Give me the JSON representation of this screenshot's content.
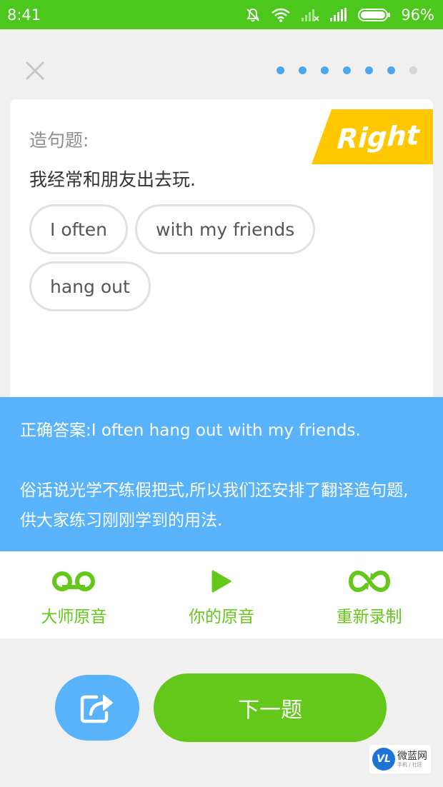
{
  "status_bar": {
    "time": "8:41",
    "battery": "96%"
  },
  "progress": {
    "completed": 6,
    "total": 7,
    "active_color": "#4ca6f0",
    "inactive_color": "#d6d6d6"
  },
  "card": {
    "badge": "Right",
    "question_type": "造句题:",
    "sentence": "我经常和朋友出去玩.",
    "chips": [
      "I often",
      "with my friends",
      "hang out"
    ]
  },
  "answer": {
    "correct_answer": "正确答案:I often hang out with my friends.",
    "explanation": "俗话说光学不练假把式,所以我们还安排了翻译造句题,供大家练习刚刚学到的用法."
  },
  "toolbar": {
    "master_audio": "大师原音",
    "your_audio": "你的原音",
    "rerecord": "重新录制"
  },
  "actions": {
    "next": "下一题"
  },
  "watermark": {
    "name": "微蓝网",
    "sub": "手机 / 社区",
    "logo_text": "VL"
  },
  "colors": {
    "green": "#64c81a",
    "blue": "#58b3fb",
    "yellow": "#ffc700",
    "status_green": "#4cc71c"
  }
}
